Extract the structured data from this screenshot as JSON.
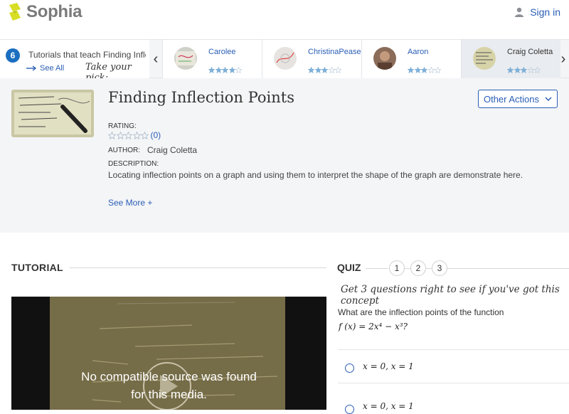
{
  "header": {
    "brand": "Sophia",
    "signin_label": "Sign in"
  },
  "strip": {
    "count": "6",
    "count_text": "Tutorials that teach Finding Infle",
    "see_all": "See All",
    "pick_text": "Take your pick:",
    "prev_icon": "‹",
    "next_icon": "›",
    "cards": [
      {
        "name": "Carolee",
        "rating": 4
      },
      {
        "name": "ChristinaPease",
        "rating": 3
      },
      {
        "name": "Aaron",
        "rating": 3
      },
      {
        "name": "Craig Coletta",
        "rating": 3
      }
    ]
  },
  "overview": {
    "title": "Finding Inflection Points",
    "other_actions": "Other Actions",
    "rating_label": "RATING:",
    "rating_count": "(0)",
    "author_label": "AUTHOR:",
    "author": "Craig Coletta",
    "description_label": "DESCRIPTION:",
    "description": "Locating inflection points on a graph and using them to interpret the shape of the graph are demonstrate here.",
    "see_more": "See More +"
  },
  "tutorial": {
    "heading": "TUTORIAL",
    "video_message_line1": "No compatible source was found",
    "video_message_line2": "for this media."
  },
  "quiz": {
    "heading": "QUIZ",
    "numbers": [
      "1",
      "2",
      "3"
    ],
    "prompt": "Get 3 questions right to see if you've got this concept",
    "question": "What are the inflection points of the function",
    "formula": "f (x) = 2x⁴ − x³?",
    "options": [
      "x = 0,  x = 1",
      "x = 0,  x = 1"
    ]
  },
  "colors": {
    "accent": "#2a5eb5",
    "badge": "#1b6fc0",
    "panel_bg": "#f4f5f7",
    "star": "#7fb0d8"
  }
}
